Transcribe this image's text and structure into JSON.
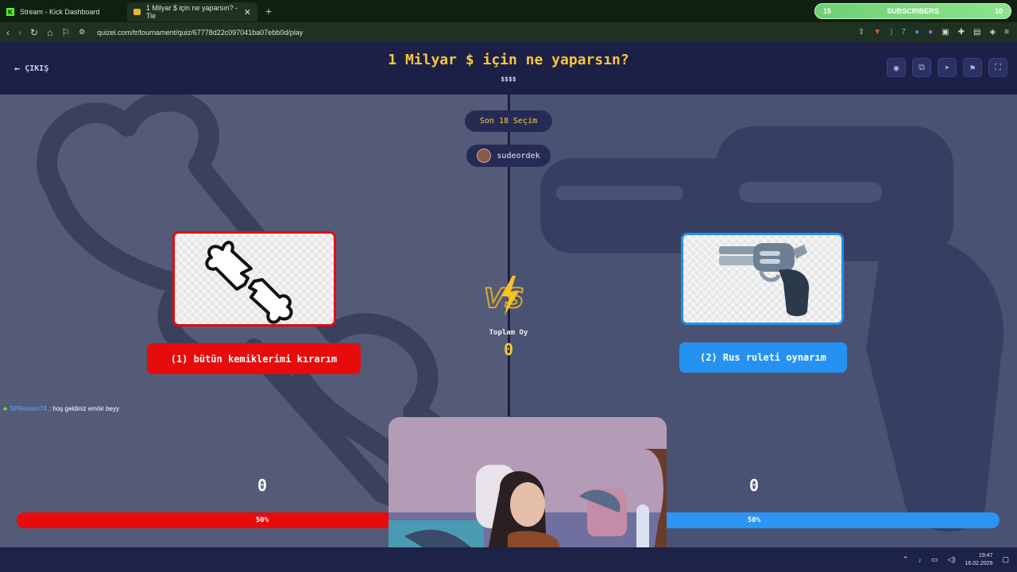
{
  "browser": {
    "tabs": [
      {
        "label": "Stream - Kick Dashboard"
      },
      {
        "label": "1 Milyar $ için ne yaparsın? - Tie"
      }
    ],
    "new_tab": "+",
    "url": "quizei.com/tr/tournament/quiz/67778d22c097041ba07ebb0d/play"
  },
  "subscribers": {
    "label": "SUBSCRIBERS",
    "current": "15",
    "goal": "10"
  },
  "header": {
    "exit_label": "ÇIKIŞ",
    "title": "1 Milyar $ için ne yaparsın?",
    "subtitle": "$$$$",
    "actions": [
      "eye-icon",
      "share-icon",
      "send-icon",
      "flag-icon",
      "fullscreen-icon"
    ]
  },
  "round": {
    "label": "Son 18 Seçim"
  },
  "host": {
    "name": "sudeordek"
  },
  "options": [
    {
      "label": "(1) bütün kemiklerimi kırarım",
      "votes": "0",
      "percent_label": "50%",
      "image": "broken-bone",
      "accent": "#e60c0c"
    },
    {
      "label": "(2) Rus ruleti oynarım",
      "votes": "0",
      "percent_label": "50%",
      "image": "revolver",
      "accent": "#2592f2"
    }
  ],
  "totals": {
    "label": "Toplam Oy",
    "value": "0"
  },
  "chat": {
    "user": "SPRemsin74",
    "message": ": hoş geldiniz emöir beyy"
  },
  "taskbar": {
    "time": "19:47",
    "date": "16.02.2026"
  }
}
